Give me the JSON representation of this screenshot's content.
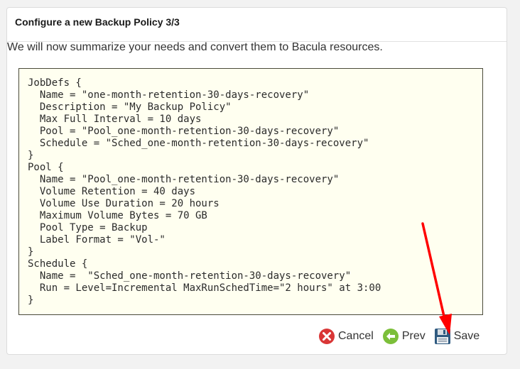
{
  "dialog": {
    "title": "Configure a new Backup Policy 3/3",
    "intro": "We will now summarize your needs and convert them to Bacula resources.",
    "config_lines": [
      "JobDefs {",
      "  Name = \"one-month-retention-30-days-recovery\"",
      "  Description = \"My Backup Policy\"",
      "  Max Full Interval = 10 days",
      "  Pool = \"Pool_one-month-retention-30-days-recovery\"",
      "  Schedule = \"Sched_one-month-retention-30-days-recovery\"",
      "}",
      "Pool {",
      "  Name = \"Pool_one-month-retention-30-days-recovery\"",
      "  Volume Retention = 40 days",
      "  Volume Use Duration = 20 hours",
      "  Maximum Volume Bytes = 70 GB",
      "  Pool Type = Backup",
      "  Label Format = \"Vol-\"",
      "}",
      "Schedule {",
      "  Name =  \"Sched_one-month-retention-30-days-recovery\"",
      "  Run = Level=Incremental MaxRunSchedTime=\"2 hours\" at 3:00",
      "}"
    ]
  },
  "actions": {
    "cancel_label": "Cancel",
    "prev_label": "Prev",
    "save_label": "Save",
    "cancel_icon": "cancel-icon",
    "prev_icon": "arrow-left-icon",
    "save_icon": "floppy-disk-icon"
  },
  "colors": {
    "cancel": "#d93636",
    "prev": "#7cbf3a",
    "save": "#2f5a80",
    "annotation_arrow": "#ff0000",
    "code_background": "#fffff0"
  }
}
